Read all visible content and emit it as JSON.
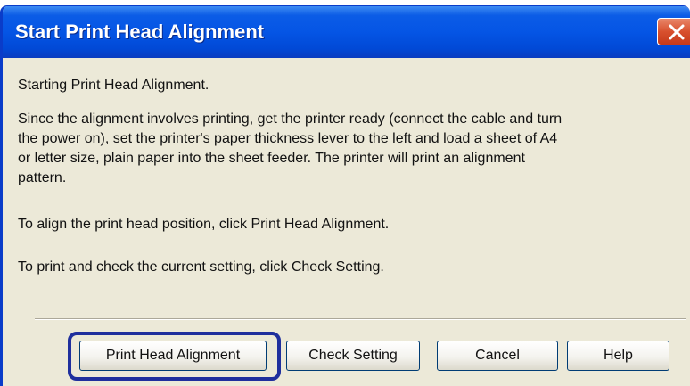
{
  "window": {
    "title": "Start Print Head Alignment"
  },
  "content": {
    "intro": "Starting Print Head Alignment.",
    "paragraph_lines": [
      "Since the alignment involves printing, get the printer ready (connect the cable and turn",
      "the power on), set the printer's paper thickness lever to the left and load a sheet of A4",
      "or letter size, plain paper into the sheet feeder. The printer will print an alignment",
      "pattern."
    ],
    "align_instruction": "To align the print head position, click Print Head Alignment.",
    "check_instruction": "To print and check the current setting, click Check Setting."
  },
  "buttons": {
    "print_head_alignment": "Print Head Alignment",
    "check_setting": "Check Setting",
    "cancel": "Cancel",
    "help": "Help"
  },
  "colors": {
    "titlebar": "#0555e5",
    "close_button": "#d8502e",
    "dialog_face": "#ece9d8",
    "highlight_frame": "#1f2f9d"
  },
  "icons": {
    "close": "close-icon"
  }
}
